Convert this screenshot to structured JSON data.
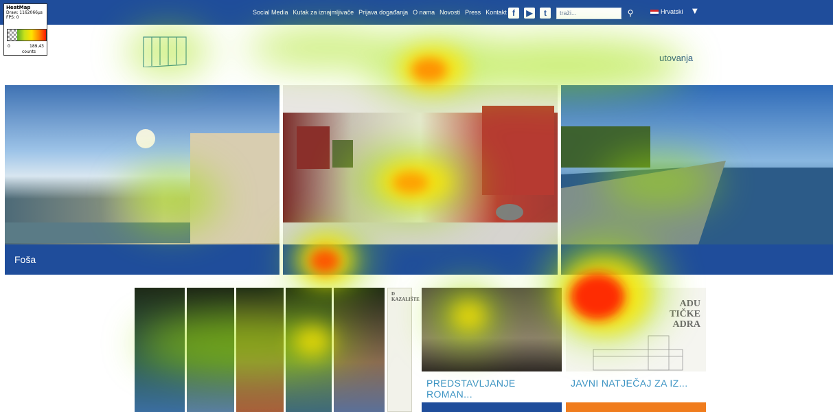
{
  "nav": {
    "items": [
      "Social Media",
      "Kutak za iznajmljivače",
      "Prijava događanja",
      "O nama",
      "Novosti",
      "Press",
      "Kontakt"
    ],
    "social_icons": [
      "facebook-icon",
      "youtube-icon",
      "twitter-icon"
    ],
    "search_placeholder": "traži...",
    "language": "Hrvatski"
  },
  "header": {
    "right_link": "utovanja"
  },
  "hero": {
    "slides": [
      {
        "caption": "Foša"
      },
      {
        "caption": ""
      },
      {
        "caption": ""
      }
    ]
  },
  "poster": {
    "side_title": "D KAZALIŠTE"
  },
  "cards": [
    {
      "title": "PREDSTAVLJANJE ROMAN..."
    },
    {
      "title": "JAVNI NATJEČAJ ZA IZ...",
      "heading_lines": [
        "ADU",
        "TIČKE",
        "ADRA"
      ]
    }
  ],
  "heatmap_panel": {
    "title": "HeatMap",
    "draw": "Draw: 1162066µs",
    "fps": "FPS: 0",
    "min": "0",
    "max": "189,43",
    "unit": "counts"
  },
  "colors": {
    "nav_blue": "#1f4d9b",
    "accent_orange": "#f07c1d",
    "link_blue": "#3b93c3"
  }
}
